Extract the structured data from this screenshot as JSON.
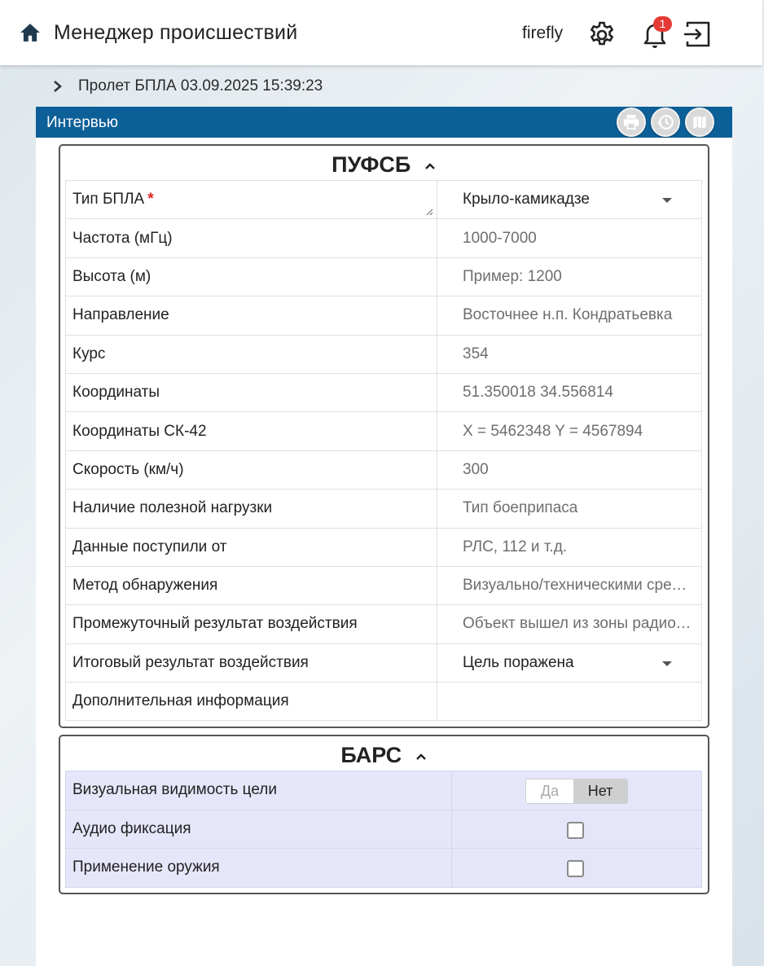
{
  "header": {
    "title": "Менеджер происшествий",
    "username": "firefly",
    "notification_count": "1",
    "icons": [
      "home-icon",
      "gear-icon",
      "bell-icon",
      "logout-icon"
    ]
  },
  "breadcrumb": {
    "label": "Пролет БПЛА 03.09.2025 15:39:23"
  },
  "panel": {
    "title": "Интервью",
    "accent_color": "#0d5f98",
    "tools": [
      "print-icon",
      "history-icon",
      "map-icon"
    ]
  },
  "pufsb": {
    "title": "ПУФСБ",
    "rows": [
      {
        "label": "Тип БПЛА",
        "required": "*",
        "value": "Крыло-камикадзе"
      },
      {
        "label": "Частота (мГц)",
        "value": "1000-7000"
      },
      {
        "label": "Высота (м)",
        "value": "Пример: 1200"
      },
      {
        "label": "Направление",
        "value": "Восточнее н.п. Кондратьевка"
      },
      {
        "label": "Курс",
        "value": "354"
      },
      {
        "label": "Координаты",
        "value": "51.350018 34.556814"
      },
      {
        "label": "Координаты СК-42",
        "value": "X = 5462348 Y = 4567894"
      },
      {
        "label": "Скорость (км/ч)",
        "value": "300"
      },
      {
        "label": "Наличие полезной нагрузки",
        "value": "Тип боеприпаса"
      },
      {
        "label": "Данные поступили от",
        "value": "РЛС, 112 и т.д."
      },
      {
        "label": "Метод обнаружения",
        "value": "Визуально/техническими средствами"
      },
      {
        "label": "Промежуточный результат воздействия",
        "value": "Объект вышел из зоны радиолокационного контроля"
      },
      {
        "label": "Итоговый результат воздействия",
        "value": "Цель поражена"
      },
      {
        "label": "Дополнительная информация",
        "value": ""
      }
    ]
  },
  "bars": {
    "title": "БАРС",
    "visual": {
      "label": "Визуальная видимость цели",
      "yes": "Да",
      "no": "Нет",
      "selected": "Нет"
    },
    "audio": {
      "label": "Аудио фиксация",
      "checked": false
    },
    "weapon": {
      "label": "Применение оружия",
      "checked": false
    }
  }
}
